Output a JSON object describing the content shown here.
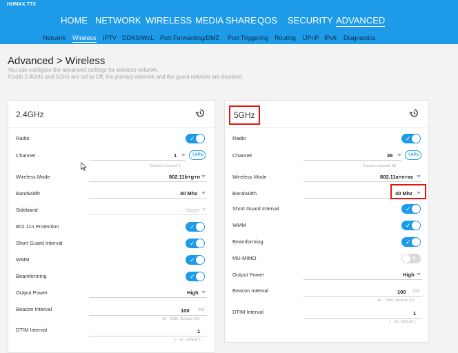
{
  "brand": "HUMAX T7X",
  "main_nav": [
    {
      "label": "HOME"
    },
    {
      "label": "NETWORK"
    },
    {
      "label": "WIRELESS"
    },
    {
      "label": "MEDIA SHARE"
    },
    {
      "label": "QOS"
    },
    {
      "label": "SECURITY"
    },
    {
      "label": "ADVANCED",
      "active": true
    }
  ],
  "sub_nav": [
    {
      "label": "Network"
    },
    {
      "label": "Wireless",
      "active": true
    },
    {
      "label": "IPTV"
    },
    {
      "label": "DDNS/WoL"
    },
    {
      "label": "Port Forwarding/DMZ"
    },
    {
      "label": "Port Triggering"
    },
    {
      "label": "Routing"
    },
    {
      "label": "UPnP"
    },
    {
      "label": "IPv6"
    },
    {
      "label": "Diagnostics"
    }
  ],
  "page": {
    "title": "Advanced > Wireless",
    "desc1": "You can configure the advanced settings for wireless network.",
    "desc2": "If both 2.4GHz and 5GHz are set to Off, the primary network and the guest network are disabled."
  },
  "panel24": {
    "title": "2.4GHz",
    "radio": {
      "label": "Radio",
      "on": true
    },
    "channel": {
      "label": "Channel",
      "value": "1",
      "aps": "APs",
      "hint": "Current channel: 1"
    },
    "mode": {
      "label": "Wireless Mode",
      "value": "802.11b+g+n"
    },
    "bandwidth": {
      "label": "Bandwidth",
      "value": "40 Mhz"
    },
    "sideband": {
      "label": "Sideband",
      "value": "Upper"
    },
    "protection": {
      "label": "802.11n Protection",
      "on": true
    },
    "sgi": {
      "label": "Short Guard Interval",
      "on": true
    },
    "wmm": {
      "label": "WMM",
      "on": true
    },
    "beamforming": {
      "label": "Beamforming",
      "on": true
    },
    "power": {
      "label": "Output Power",
      "value": "High"
    },
    "beacon": {
      "label": "Beacon Interval",
      "value": "100",
      "unit": "ms",
      "hint": "40 - 1000, Default 100"
    },
    "dtim": {
      "label": "DTIM Interval",
      "value": "1",
      "hint": "1 - 15, Default 1"
    }
  },
  "panel5": {
    "title": "5GHz",
    "radio": {
      "label": "Radio",
      "on": true
    },
    "channel": {
      "label": "Channel",
      "value": "36",
      "aps": "APs",
      "hint": "Current channel: 36"
    },
    "mode": {
      "label": "Wireless Mode",
      "value": "802.11a+n+ac"
    },
    "bandwidth": {
      "label": "Bandwidth",
      "value": "40 Mhz"
    },
    "sgi": {
      "label": "Short Guard Interval",
      "on": true
    },
    "wmm": {
      "label": "WMM",
      "on": true
    },
    "beamforming": {
      "label": "Beamforming",
      "on": true
    },
    "mumimo": {
      "label": "MU-MIMO",
      "on": false
    },
    "power": {
      "label": "Output Power",
      "value": "High"
    },
    "beacon": {
      "label": "Beacon Interval",
      "value": "100",
      "unit": "ms",
      "hint": "40 - 1000, Default 100"
    },
    "dtim": {
      "label": "DTIM Interval",
      "value": "1",
      "hint": "1 - 15, Default 1"
    }
  },
  "colors": {
    "accent": "#1e9be8",
    "highlight": "#e8140c",
    "toggle_off": "#d9d9d9"
  },
  "icons": {
    "history": "history-icon",
    "search": "search-icon",
    "cursor": "mouse-cursor-icon"
  }
}
